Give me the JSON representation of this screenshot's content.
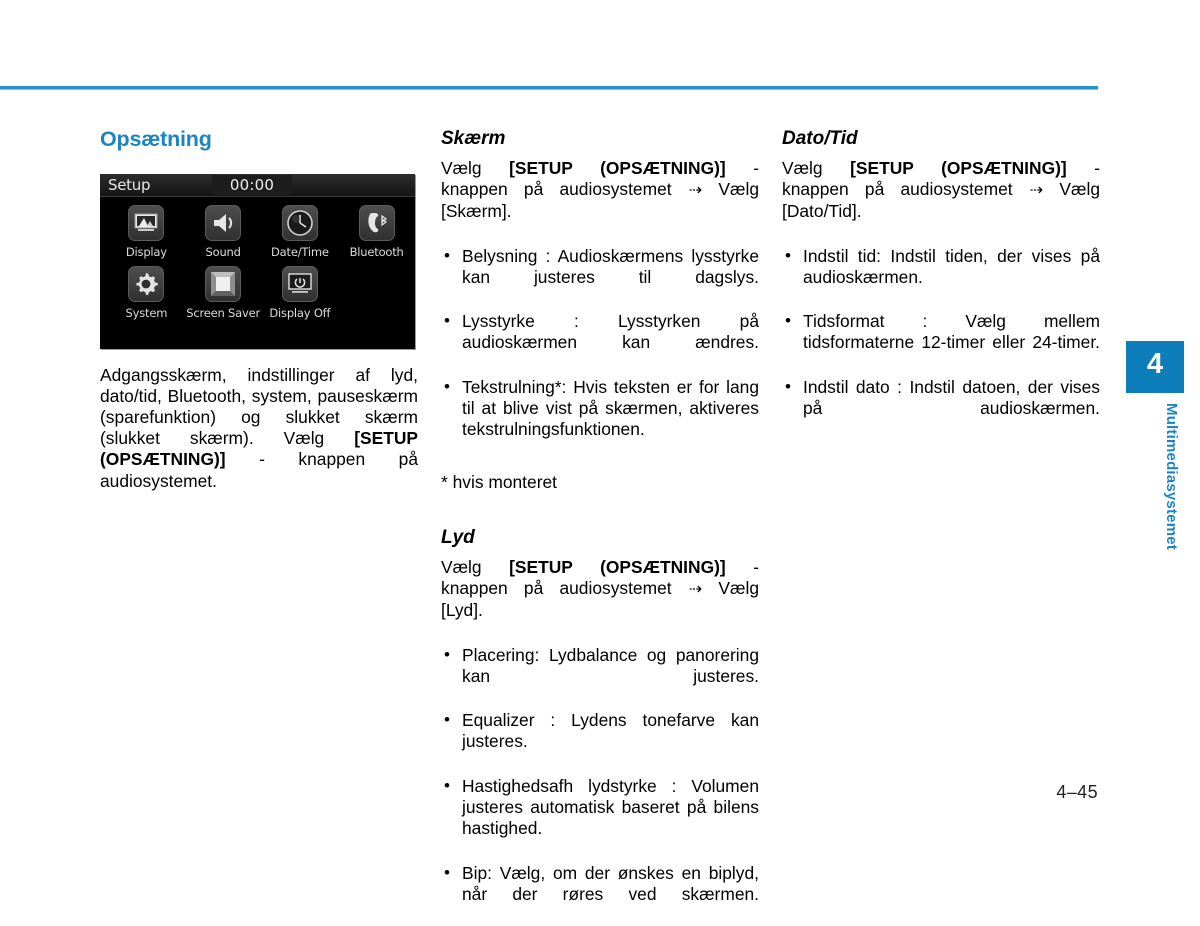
{
  "page": {
    "number": "4–45",
    "accent_blue": "#1d84c4",
    "tab_blue": "#0e7ebb",
    "rule_blue": "#2b8fc9"
  },
  "chapter_tab": {
    "number": "4",
    "name": "Multimediasystemet"
  },
  "column1": {
    "heading": "Opsætning",
    "screen": {
      "title": "Setup",
      "clock": "00:00",
      "icons": [
        {
          "label": "Display",
          "icon": "picture-icon"
        },
        {
          "label": "Sound",
          "icon": "speaker-icon"
        },
        {
          "label": "Date/Time",
          "icon": "clock-icon"
        },
        {
          "label": "Bluetooth",
          "icon": "bluetooth-phone-icon"
        },
        {
          "label": "System",
          "icon": "gear-icon"
        },
        {
          "label": "Screen Saver",
          "icon": "screen-saver-icon"
        },
        {
          "label": "Display Off",
          "icon": "display-off-icon"
        }
      ]
    },
    "paragraph_part1": "Adgangsskærm, indstillinger af lyd, dato/tid, Bluetooth, system, pauseskærm (sparefunktion) og slukket skærm (slukket skærm). Vælg ",
    "paragraph_bold": "[SETUP (OPSÆTNING)]",
    "paragraph_part2": " - knappen på audiosystemet."
  },
  "column2": {
    "section1": {
      "heading": "Skærm",
      "intro_part1": "Vælg ",
      "intro_bold": "[SETUP (OPSÆTNING)]",
      "intro_part2": " - knappen på audiosystemet ",
      "arrow": "⇢",
      "intro_part3": " Vælg [Skærm].",
      "bullets": [
        "Belysning : Audioskærmens lysstyrke kan justeres til dagslys.",
        "Lysstyrke : Lysstyrken på audioskærmen kan ændres.",
        "Tekstrulning*: Hvis teksten er for lang til at blive vist på skærmen, aktiveres tekstrulningsfunktionen."
      ],
      "footnote": "* hvis monteret"
    },
    "section2": {
      "heading": "Lyd",
      "intro_part1": "Vælg ",
      "intro_bold": "[SETUP (OPSÆTNING)]",
      "intro_part2": " - knappen på audiosystemet ",
      "arrow": "⇢",
      "intro_part3": " Vælg [Lyd].",
      "bullets": [
        "Placering: Lydbalance og panorering kan justeres.",
        "Equalizer : Lydens tonefarve kan justeres.",
        "Hastighedsafh lydstyrke : Volumen justeres automatisk baseret på bilens hastighed.",
        "Bip: Vælg, om der ønskes en biplyd, når der røres ved skærmen."
      ]
    }
  },
  "column3": {
    "section1": {
      "heading": "Dato/Tid",
      "intro_part1": "Vælg ",
      "intro_bold": "[SETUP (OPSÆTNING)]",
      "intro_part2": " - knappen på audiosystemet ",
      "arrow": "⇢",
      "intro_part3": " Vælg [Dato/Tid].",
      "bullets": [
        "Indstil tid: Indstil tiden, der vises på audioskærmen.",
        "Tidsformat : Vælg mellem tidsformaterne 12-timer eller 24-timer.",
        "Indstil dato : Indstil datoen, der vises på audioskærmen."
      ]
    }
  }
}
